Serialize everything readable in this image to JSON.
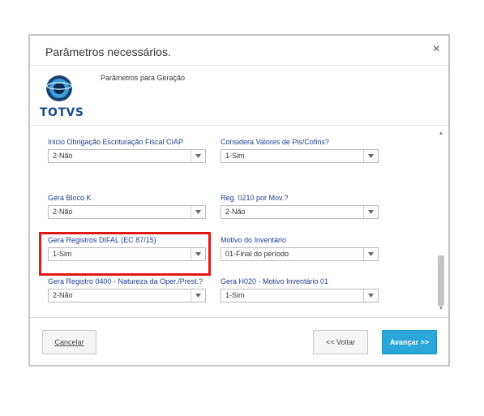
{
  "dialog": {
    "title": "Parâmetros necessários.",
    "close_symbol": "×",
    "logo_text": "TOTVS",
    "subtitle": "Parâmetros para Geração"
  },
  "fields": [
    {
      "label": "Inicio Obrigação Escrituração Fiscal CIAP",
      "value": "2-Não"
    },
    {
      "label": "Considera Valores de Pis/Cofins?",
      "value": "1-Sim"
    },
    {
      "label": "Gera Bloco K",
      "value": "2-Não"
    },
    {
      "label": "Reg. 0210 por Mov.?",
      "value": "2-Não"
    },
    {
      "label": "Gera Registros DIFAL (EC 87/15)",
      "value": "1-Sim"
    },
    {
      "label": "Motivo do Inventário",
      "value": "01-Final do período"
    },
    {
      "label": "Gera Registro 0400 - Natureza da Oper./Prest.?",
      "value": "2-Não"
    },
    {
      "label": "Gera H020 - Motivo Inventário 01",
      "value": "1-Sim"
    }
  ],
  "buttons": {
    "cancel": "Cancelar",
    "back": "<< Voltar",
    "next": "Avançar >>"
  },
  "colors": {
    "highlight": "#e11616",
    "primary": "#29a7d9",
    "label": "#1f3c8f"
  }
}
